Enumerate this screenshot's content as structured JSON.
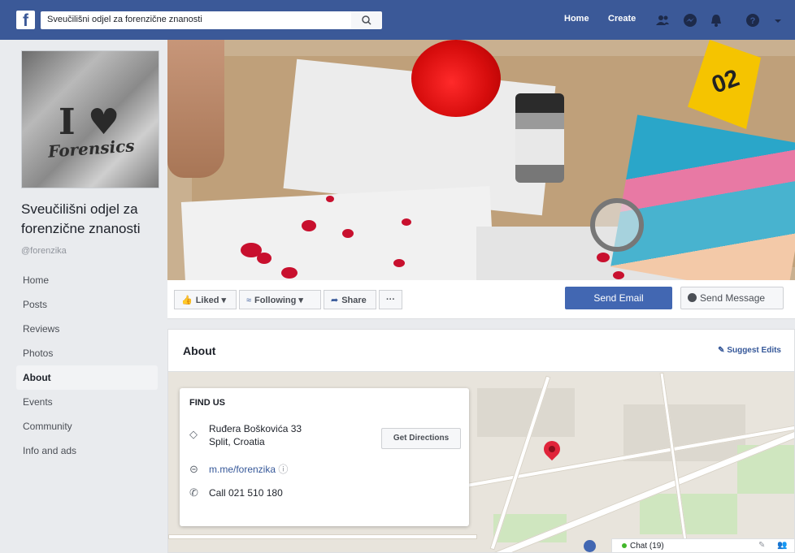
{
  "topbar": {
    "logo": "f",
    "search_value": "Sveučilišni odjel za forenzične znanosti",
    "nav_home": "Home",
    "nav_create": "Create",
    "icons": [
      "friends-icon",
      "messenger-icon",
      "notifications-icon",
      "help-icon",
      "menu-caret-icon"
    ]
  },
  "profile": {
    "pic_text_line1": "I ♥",
    "pic_text_line2": "Forensics",
    "name": "Sveučilišni odjel za forenzične znanosti",
    "handle": "@forenzika"
  },
  "sidebar": {
    "items": [
      {
        "label": "Home"
      },
      {
        "label": "Posts"
      },
      {
        "label": "Reviews"
      },
      {
        "label": "Photos"
      },
      {
        "label": "About"
      },
      {
        "label": "Events"
      },
      {
        "label": "Community"
      },
      {
        "label": "Info and ads"
      }
    ],
    "active": "About"
  },
  "cover": {
    "marker_number": "02"
  },
  "actions": {
    "liked": "Liked",
    "following": "Following",
    "share": "Share",
    "more": "···",
    "send_email": "Send Email",
    "send_message": "Send Message"
  },
  "about": {
    "title": "About",
    "suggest_edits": "Suggest Edits",
    "find_us": "FIND US",
    "address_line1": "Ruđera Boškovića 33",
    "address_line2": "Split, Croatia",
    "get_directions": "Get Directions",
    "messenger_link": "m.me/forenzika",
    "phone": "Call 021 510 180"
  },
  "chat": {
    "label": "Chat (19)"
  },
  "colors": {
    "brand": "#3b5998",
    "button_blue": "#4267b2",
    "link": "#365899",
    "pin": "#e0243a"
  }
}
